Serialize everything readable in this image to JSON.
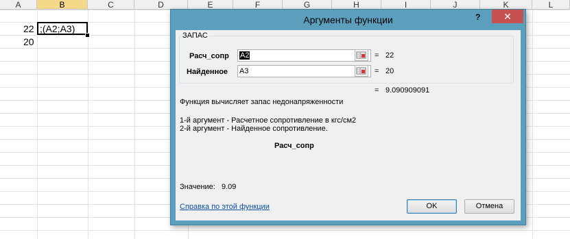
{
  "spreadsheet": {
    "columns": [
      "A",
      "B",
      "C",
      "D",
      "E",
      "F",
      "G",
      "H",
      "I",
      "J",
      "K",
      "L"
    ],
    "selected_column": "B",
    "cells": {
      "a2": "22",
      "a3": "20",
      "b2_formula": ";(A2;A3)"
    }
  },
  "dialog": {
    "title": "Аргументы функции",
    "help_glyph": "?",
    "close_glyph": "✕",
    "function_name": "ЗАПАС",
    "args": [
      {
        "label": "Расч_сопр",
        "value": "A2",
        "result": "22"
      },
      {
        "label": "Найденное",
        "value": "A3",
        "result": "20"
      }
    ],
    "equals": "=",
    "function_result": "9.090909091",
    "description": "Функция вычисляет запас недонапряженности",
    "arg_help_1": "1-й аргумент - Расчетное сопротивление в кгс/см2",
    "arg_help_2": "2-й аргумент - Найденное сопротивление.",
    "current_arg": "Расч_сопр",
    "value_label": "Значение:",
    "value": "9.09",
    "help_link": "Справка по этой функции",
    "ok_label": "OK",
    "cancel_label": "Отмена"
  }
}
